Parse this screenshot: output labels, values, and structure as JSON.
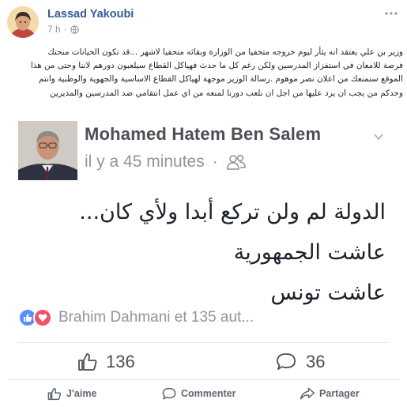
{
  "post": {
    "author": "Lassad Yakoubi",
    "time": "7 h",
    "visibility_icon": "globe-icon",
    "text_lines": [
      "وزير بن علي يعتقد انه يثأر ليوم خروجه متخفيا من الوزارة وبقائه متخفيا لاشهر ...قد تكون الخيانات منحتك",
      "فرصة للامعان في استفزاز المدرسين ولكن رغم كل ما حدث فهياكل القطاع سيلعبون دورهم لاننا وحتى من هذا",
      "الموقع سنمنعك من اعلان نصر موهوم .رسالة الوزير موجهة لهياكل القطاع الاساسية والجهوية والوطنية وانتم",
      "وحدكم من يجب ان يرد عليها من اجل ان نلعب دورنا لمنعه من اي عمل انتقامي ضد المدرسين والمديرين"
    ]
  },
  "shared": {
    "name": "Mohamed Hatem Ben Salem",
    "time": "il y a 45 minutes",
    "audience_icon": "friends-icon",
    "body_lines": [
      "الدولة لم ولن تركع أبدا ولأي كان...",
      "عاشت الجمهورية",
      "عاشت تونس"
    ],
    "reactors": "Brahim Dahmani et 135 aut...",
    "like_count": "136",
    "comment_count": "36"
  },
  "actions": {
    "like": "J'aime",
    "comment": "Commenter",
    "share": "Partager"
  },
  "colors": {
    "link_blue": "#365899",
    "meta_gray": "#90949c",
    "like_blue": "#5890ff",
    "love_red": "#f25268"
  }
}
